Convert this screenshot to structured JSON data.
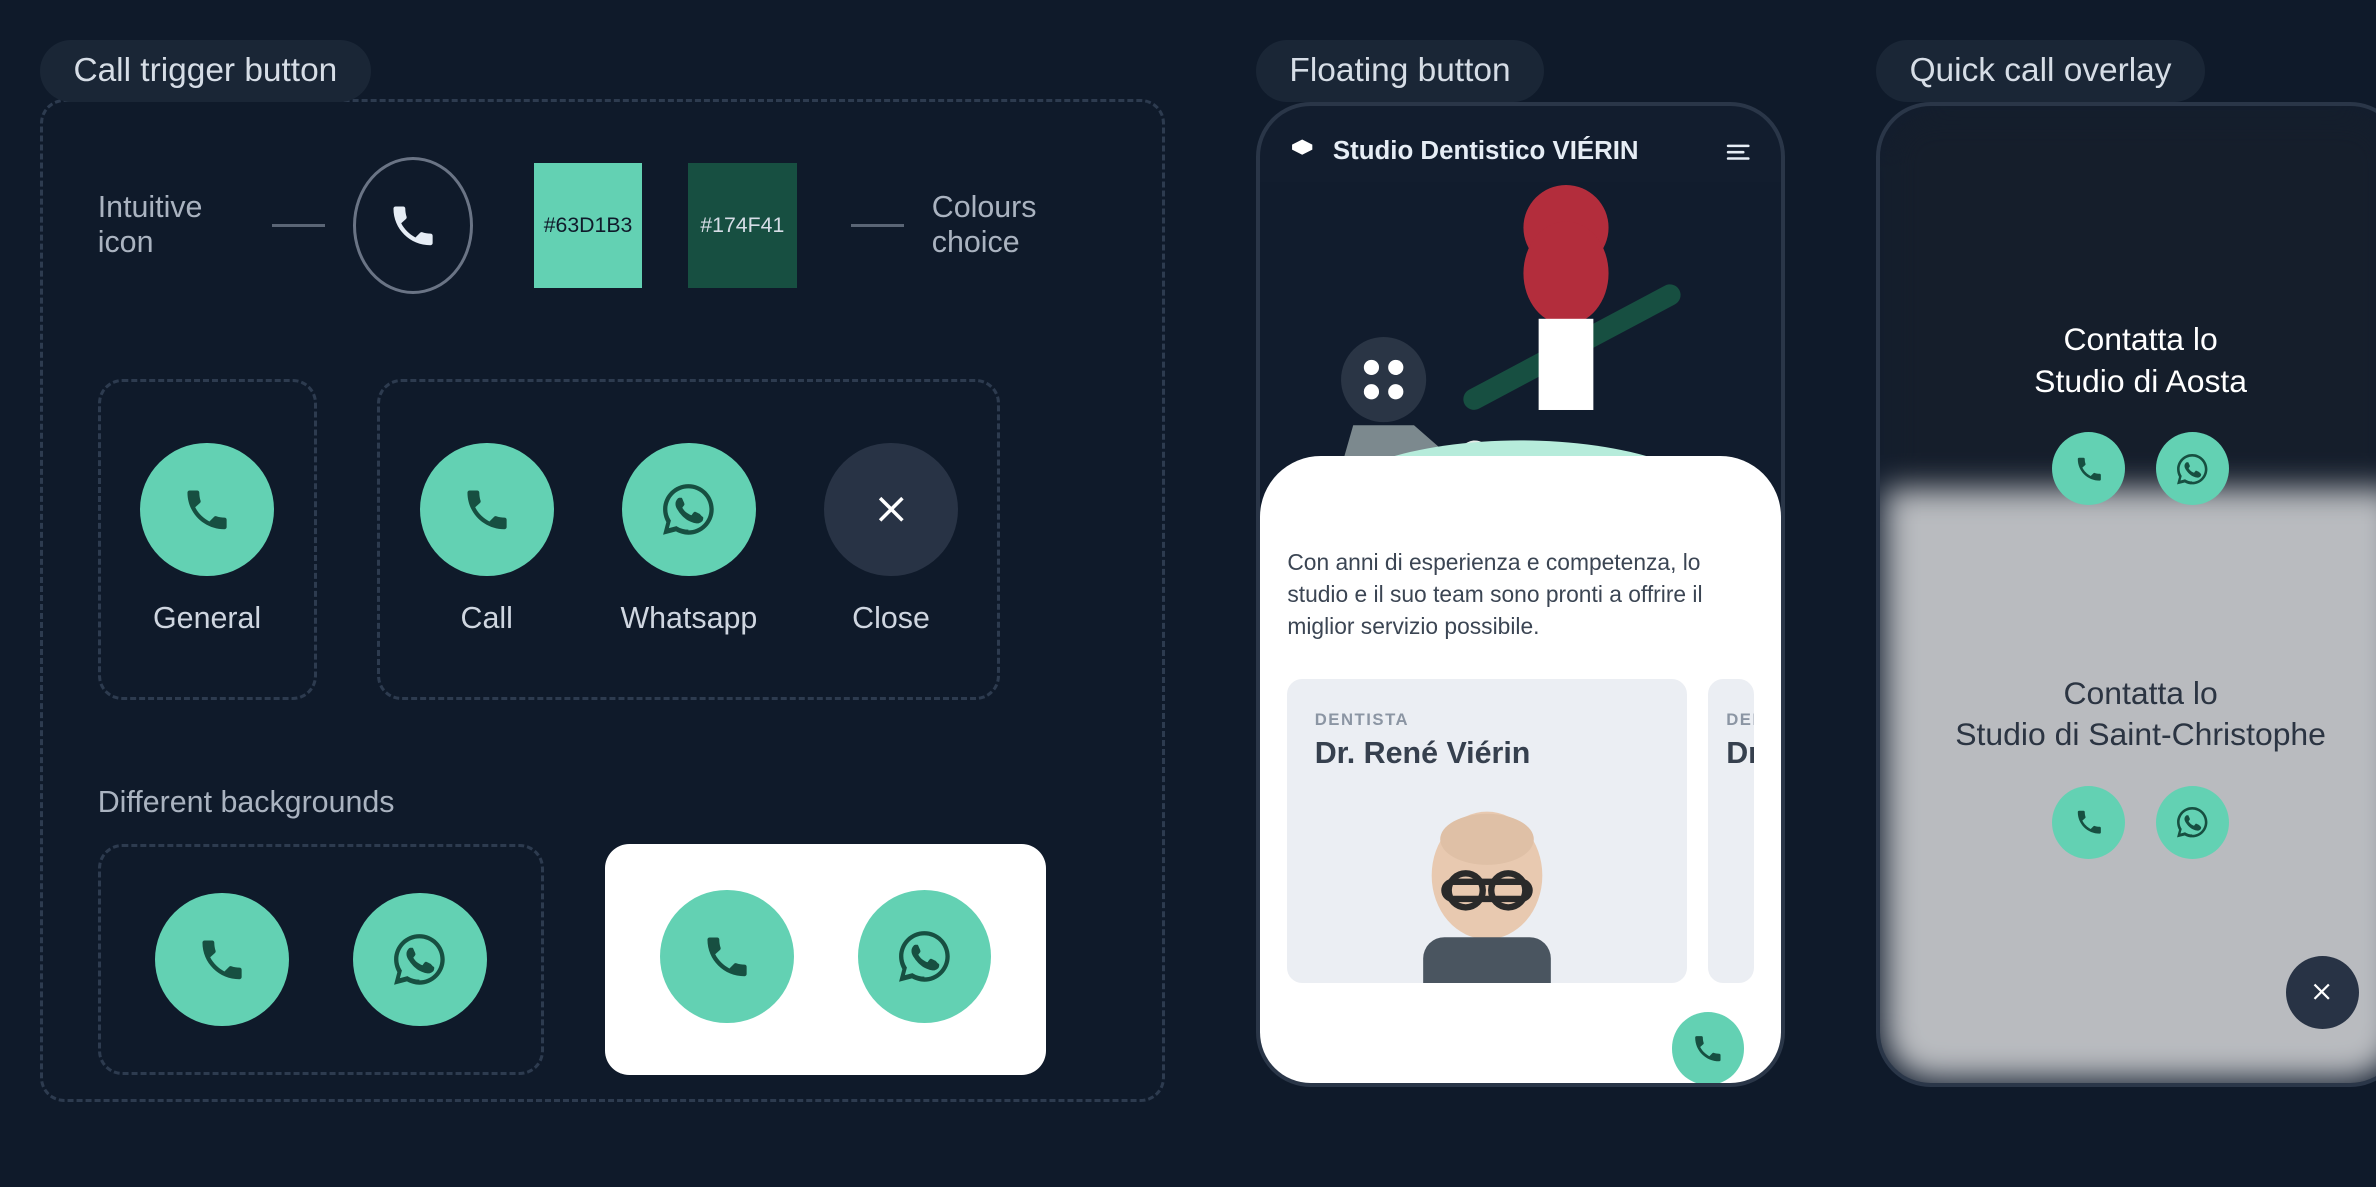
{
  "sections": {
    "left": "Call trigger button",
    "mid": "Floating button",
    "right": "Quick call overlay"
  },
  "row1": {
    "icon_label": "Intuitive icon",
    "colours_label": "Colours choice",
    "swatch_light": "#63D1B3",
    "swatch_dark": "#174F41"
  },
  "buttons": {
    "general": "General",
    "call": "Call",
    "whatsapp": "Whatsapp",
    "close": "Close"
  },
  "backgrounds_label": "Different backgrounds",
  "phone": {
    "brand": "Studio Dentistico VIÉRIN",
    "desc": "Con anni di esperienza e competenza, lo studio e il suo team sono pronti a offrire il miglior servizio possibile.",
    "role": "DENTISTA",
    "doctor": "Dr. René Viérin",
    "doctor2_prefix": "Dr"
  },
  "overlay": {
    "title1_line1": "Contatta lo",
    "title1_line2": "Studio di Aosta",
    "title2_line1": "Contatta lo",
    "title2_line2": "Studio di Saint-Christophe"
  },
  "colors": {
    "accent": "#63d1b3",
    "accent_dark": "#174f41"
  }
}
